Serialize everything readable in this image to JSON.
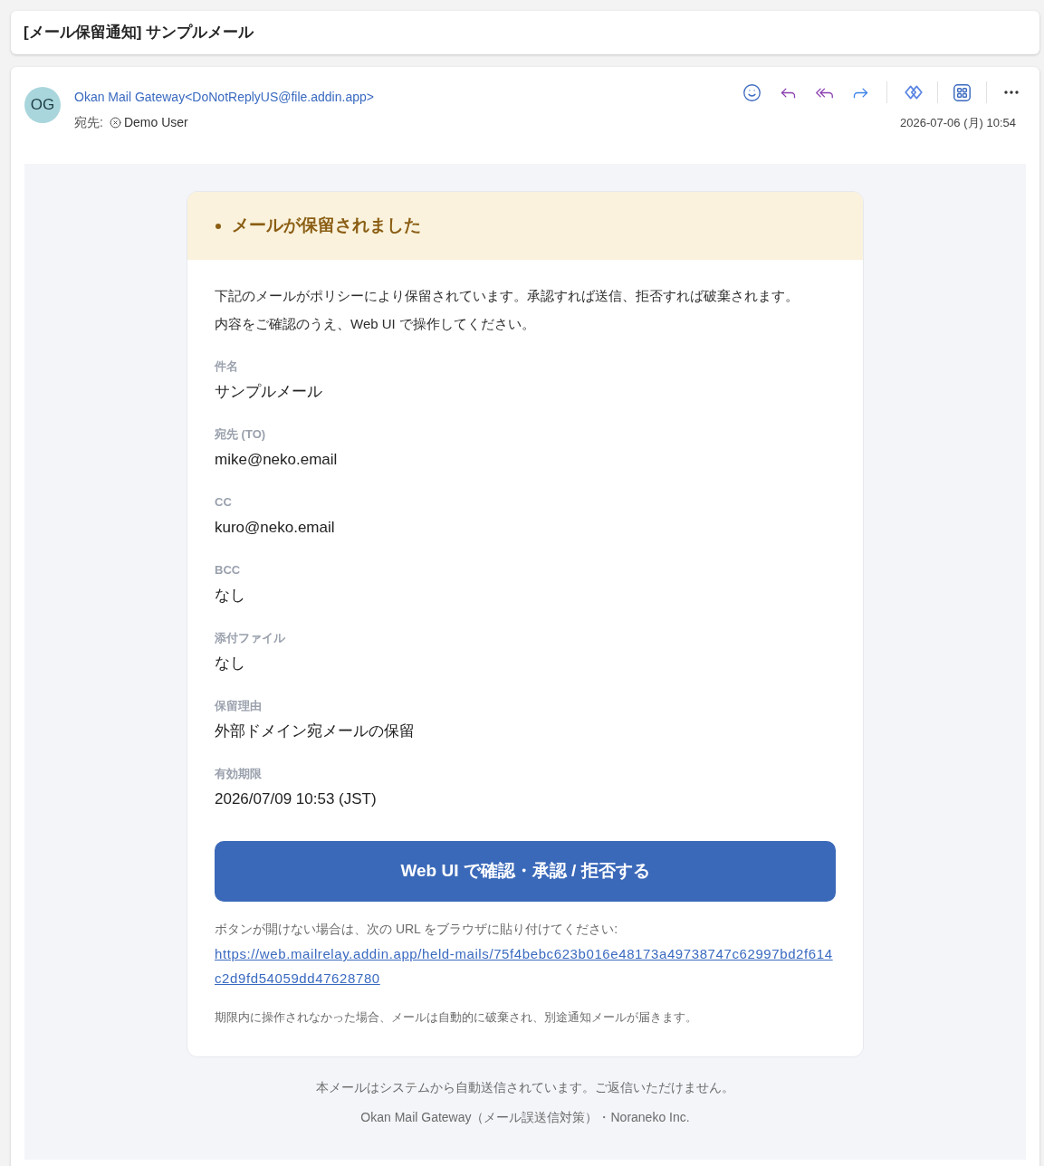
{
  "subject": "[メール保留通知] サンプルメール",
  "message": {
    "avatar_initials": "OG",
    "sender": "Okan Mail Gateway<DoNotReplyUS@file.addin.app>",
    "to_label": "宛先:",
    "recipients": [
      {
        "name": "Demo User"
      }
    ],
    "date": "2026-07-06 (月) 10:54"
  },
  "notice": {
    "title": "メールが保留されました",
    "intro": "下記のメールがポリシーにより保留されています。承認すれば送信、拒否すれば破棄されます。内容をご確認のうえ、Web UI で操作してください。",
    "fields": [
      {
        "label": "件名",
        "value": "サンプルメール"
      },
      {
        "label": "宛先 (TO)",
        "value": "mike@neko.email"
      },
      {
        "label": "CC",
        "value": "kuro@neko.email"
      },
      {
        "label": "BCC",
        "value": "なし"
      },
      {
        "label": "添付ファイル",
        "value": "なし"
      },
      {
        "label": "保留理由",
        "value": "外部ドメイン宛メールの保留"
      },
      {
        "label": "有効期限",
        "value": "2026/07/09 10:53 (JST)"
      }
    ],
    "action_button": "Web UI で確認・承認 / 拒否する",
    "fallback_text": "ボタンが開けない場合は、次の URL をブラウザに貼り付けてください:",
    "fallback_url": "https://web.mailrelay.addin.app/held-mails/75f4bebc623b016e48173a49738747c62997bd2f614c2d9fd54059dd47628780",
    "expiry_note": "期限内に操作されなかった場合、メールは自動的に破棄され、別途通知メールが届きます。"
  },
  "footer": [
    "本メールはシステムから自動送信されています。ご返信いただけません。",
    "Okan Mail Gateway（メール誤送信対策）・Noraneko Inc."
  ]
}
